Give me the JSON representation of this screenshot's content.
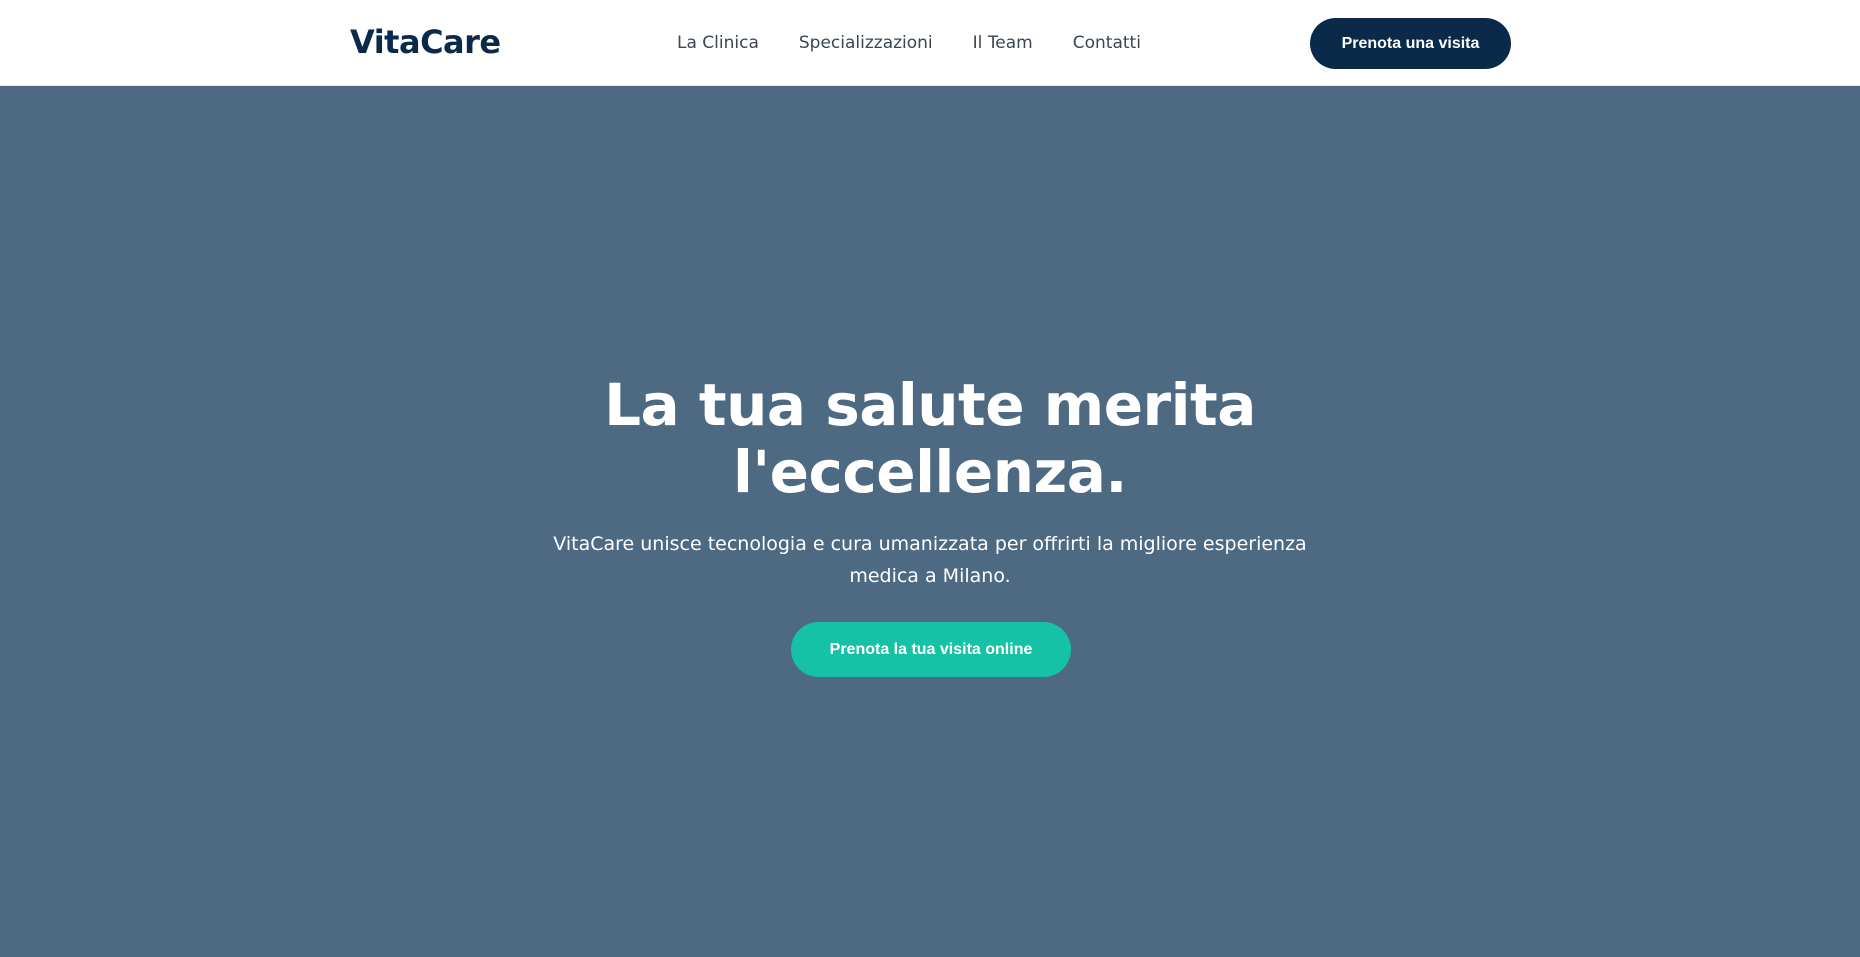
{
  "header": {
    "logo": "VitaCare",
    "nav": [
      {
        "label": "La Clinica"
      },
      {
        "label": "Specializzazioni"
      },
      {
        "label": "Il Team"
      },
      {
        "label": "Contatti"
      }
    ],
    "cta_label": "Prenota una visita"
  },
  "hero": {
    "title_line1": "La tua salute merita",
    "title_line2": "l'eccellenza.",
    "subtitle_line1": "VitaCare unisce tecnologia e cura umanizzata per offrirti la migliore esperienza",
    "subtitle_line2": "medica a Milano.",
    "cta_label": "Prenota la tua visita online"
  },
  "colors": {
    "brand_navy": "#0b2a4a",
    "hero_background": "#4d6a82",
    "accent_teal": "#16c2a5",
    "header_background": "#ffffff"
  }
}
